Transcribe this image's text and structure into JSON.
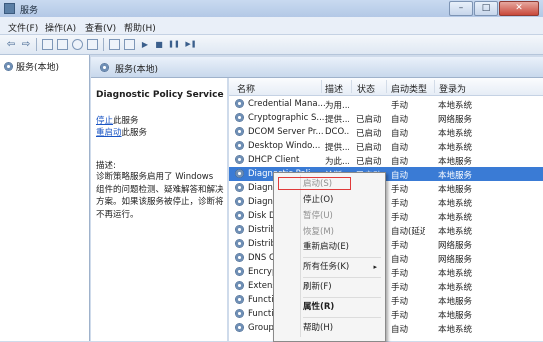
{
  "window": {
    "title": "服务",
    "min": "–",
    "max": "□",
    "close": "✕"
  },
  "menu": [
    "文件(F)",
    "操作(A)",
    "查看(V)",
    "帮助(H)"
  ],
  "toolbar": {
    "back": "⇦",
    "forward": "⇨",
    "play": "▶",
    "stop": "■",
    "pause": "❚❚",
    "restart": "▶❚"
  },
  "tree": {
    "root": "服务(本地)"
  },
  "main_header": "服务(本地)",
  "description": {
    "service_name": "Diagnostic Policy Service",
    "stop_link": "停止",
    "stop_suffix": "此服务",
    "restart_link": "重启动",
    "restart_suffix": "此服务",
    "desc_label": "描述:",
    "desc_text": "诊断策略服务启用了 Windows 组件的问题检测、疑难解答和解决方案。如果该服务被停止，诊断将不再运行。"
  },
  "columns": [
    "名称",
    "描述",
    "状态",
    "启动类型",
    "登录为"
  ],
  "rows": [
    {
      "name": "Credential Mana...",
      "desc": "为用...",
      "status": "",
      "startup": "手动",
      "logon": "本地系统"
    },
    {
      "name": "Cryptographic S...",
      "desc": "提供...",
      "status": "已启动",
      "startup": "自动",
      "logon": "网络服务"
    },
    {
      "name": "DCOM Server Pr...",
      "desc": "DCO...",
      "status": "已启动",
      "startup": "自动",
      "logon": "本地系统"
    },
    {
      "name": "Desktop Windo...",
      "desc": "提供...",
      "status": "已启动",
      "startup": "自动",
      "logon": "本地系统"
    },
    {
      "name": "DHCP Client",
      "desc": "为此...",
      "status": "已启动",
      "startup": "自动",
      "logon": "本地服务"
    },
    {
      "name": "Diagnostic Poli...",
      "desc": "诊断...",
      "status": "已启动",
      "startup": "自动",
      "logon": "本地服务"
    },
    {
      "name": "Diagnos",
      "desc": "",
      "status": "",
      "startup": "手动",
      "logon": "本地服务"
    },
    {
      "name": "Diagnos",
      "desc": "",
      "status": "",
      "startup": "手动",
      "logon": "本地系统"
    },
    {
      "name": "Disk Def",
      "desc": "",
      "status": "",
      "startup": "手动",
      "logon": "本地系统"
    },
    {
      "name": "Distribut",
      "desc": "",
      "status": "",
      "startup": "自动(延迟...",
      "logon": "本地系统"
    },
    {
      "name": "Distribut",
      "desc": "",
      "status": "",
      "startup": "手动",
      "logon": "网络服务"
    },
    {
      "name": "DNS Clie",
      "desc": "",
      "status": "",
      "startup": "自动",
      "logon": "网络服务"
    },
    {
      "name": "Encrypti",
      "desc": "",
      "status": "",
      "startup": "手动",
      "logon": "本地系统"
    },
    {
      "name": "Extensib",
      "desc": "",
      "status": "",
      "startup": "手动",
      "logon": "本地系统"
    },
    {
      "name": "Function",
      "desc": "",
      "status": "",
      "startup": "手动",
      "logon": "本地服务"
    },
    {
      "name": "Function",
      "desc": "",
      "status": "",
      "startup": "手动",
      "logon": "本地服务"
    },
    {
      "name": "Group Po",
      "desc": "",
      "status": "",
      "startup": "自动",
      "logon": "本地系统"
    }
  ],
  "context_menu": {
    "start": "启动(S)",
    "stop": "停止(O)",
    "pause": "暂停(U)",
    "resume": "恢复(M)",
    "restart": "重新启动(E)",
    "all_tasks": "所有任务(K)",
    "all_tasks_arrow": "▸",
    "refresh": "刷新(F)",
    "properties": "属性(R)",
    "help": "帮助(H)"
  },
  "colors": {
    "selection": "#3a7bd5",
    "highlight_box": "#e03a3a",
    "link": "#1a55c4"
  }
}
